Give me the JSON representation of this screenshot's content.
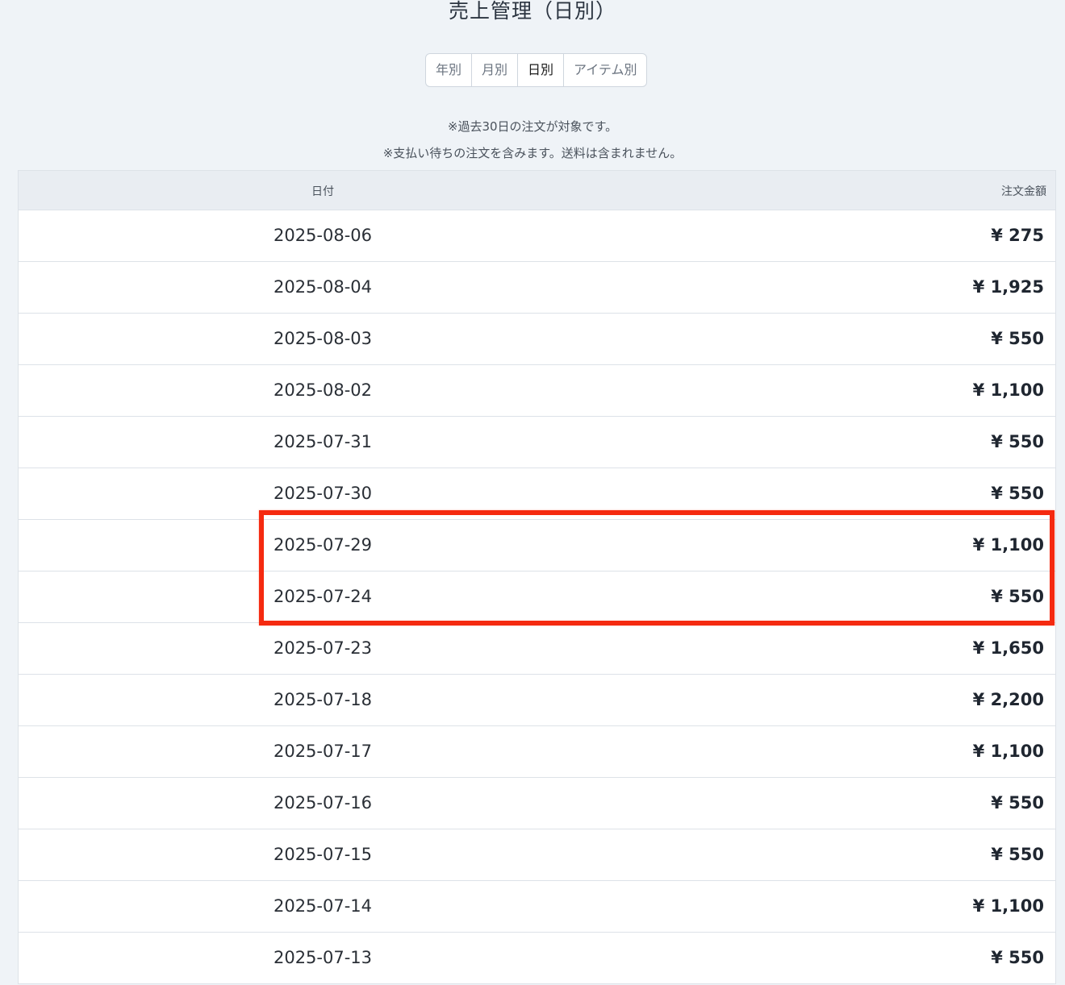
{
  "page": {
    "title": "売上管理（日別）"
  },
  "tabs": [
    {
      "label": "年別",
      "active": false
    },
    {
      "label": "月別",
      "active": false
    },
    {
      "label": "日別",
      "active": true
    },
    {
      "label": "アイテム別",
      "active": false
    }
  ],
  "notes": {
    "line1": "※過去30日の注文が対象です。",
    "line2": "※支払い待ちの注文を含みます。送料は含まれません。"
  },
  "table": {
    "headers": {
      "date": "日付",
      "amount": "注文金額"
    },
    "rows": [
      {
        "date": "2025-08-06",
        "amount": "¥ 275"
      },
      {
        "date": "2025-08-04",
        "amount": "¥ 1,925"
      },
      {
        "date": "2025-08-03",
        "amount": "¥ 550"
      },
      {
        "date": "2025-08-02",
        "amount": "¥ 1,100"
      },
      {
        "date": "2025-07-31",
        "amount": "¥ 550"
      },
      {
        "date": "2025-07-30",
        "amount": "¥ 550"
      },
      {
        "date": "2025-07-29",
        "amount": "¥ 1,100"
      },
      {
        "date": "2025-07-24",
        "amount": "¥ 550"
      },
      {
        "date": "2025-07-23",
        "amount": "¥ 1,650"
      },
      {
        "date": "2025-07-18",
        "amount": "¥ 2,200"
      },
      {
        "date": "2025-07-17",
        "amount": "¥ 1,100"
      },
      {
        "date": "2025-07-16",
        "amount": "¥ 550"
      },
      {
        "date": "2025-07-15",
        "amount": "¥ 550"
      },
      {
        "date": "2025-07-14",
        "amount": "¥ 1,100"
      },
      {
        "date": "2025-07-13",
        "amount": "¥ 550"
      }
    ]
  },
  "highlight": {
    "color": "#f52a10",
    "rows": [
      "2025-07-29",
      "2025-07-24"
    ]
  }
}
